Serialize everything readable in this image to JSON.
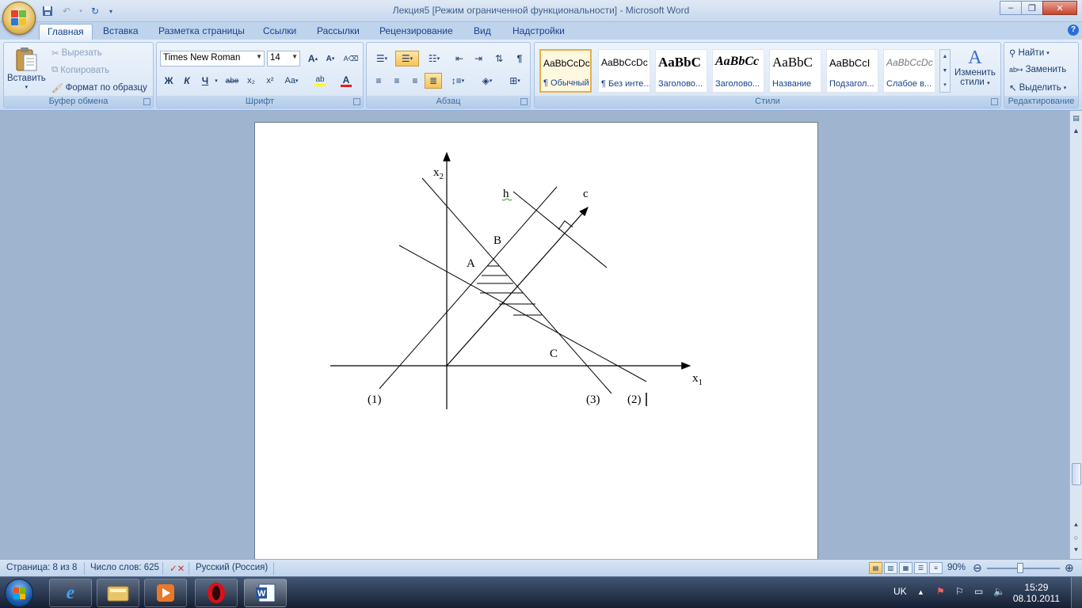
{
  "window": {
    "title": "Лекция5 [Режим ограниченной функциональности] - Microsoft Word",
    "minimize": "–",
    "maximize": "❐",
    "close": "✕"
  },
  "tabs": [
    "Главная",
    "Вставка",
    "Разметка страницы",
    "Ссылки",
    "Рассылки",
    "Рецензирование",
    "Вид",
    "Надстройки"
  ],
  "active_tab": "Главная",
  "ribbon": {
    "clipboard": {
      "label": "Буфер обмена",
      "paste": "Вставить",
      "cut": "Вырезать",
      "copy": "Копировать",
      "format_painter": "Формат по образцу"
    },
    "font": {
      "label": "Шрифт",
      "font_name": "Times New Roman",
      "font_size": "14",
      "bold": "Ж",
      "italic": "К",
      "underline": "Ч",
      "strike": "abe",
      "subscript": "x₂",
      "superscript": "x²",
      "change_case": "Аа",
      "grow": "A",
      "shrink": "A",
      "font_color": "A",
      "highlight": "ab"
    },
    "paragraph": {
      "label": "Абзац",
      "pilcrow": "¶"
    },
    "styles": {
      "label": "Стили",
      "items": [
        {
          "sample": "AaBbCcDc",
          "name": "¶ Обычный"
        },
        {
          "sample": "AaBbCcDc",
          "name": "¶ Без инте..."
        },
        {
          "sample": "AaBbC",
          "name": "Заголово..."
        },
        {
          "sample": "AaBbCc",
          "name": "Заголово..."
        },
        {
          "sample": "AaBbC",
          "name": "Название"
        },
        {
          "sample": "AaBbCcI",
          "name": "Подзагол..."
        },
        {
          "sample": "AaBbCcDc",
          "name": "Слабое в..."
        }
      ],
      "change_styles_1": "Изменить",
      "change_styles_2": "стили"
    },
    "editing": {
      "label": "Редактирование",
      "find": "Найти",
      "replace": "Заменить",
      "select": "Выделить"
    }
  },
  "figure": {
    "x2_base": "x",
    "x2_sub": "2",
    "x1_base": "x",
    "x1_sub": "1",
    "h": "h",
    "c": "c",
    "A": "A",
    "B": "B",
    "C": "C",
    "line1": "(1)",
    "line2": "(2)",
    "line3": "(3)"
  },
  "status": {
    "page": "Страница: 8 из 8",
    "words": "Число слов: 625",
    "language": "Русский (Россия)",
    "zoom": "90%"
  },
  "taskbar": {
    "lang": "UK",
    "time": "15:29",
    "date": "08.10.2011"
  },
  "colors": {
    "ribbon_text": "#15428b",
    "selected_style": "#e5b146",
    "font_color_bar": "#e02020",
    "highlight_bar": "#ffff00"
  }
}
